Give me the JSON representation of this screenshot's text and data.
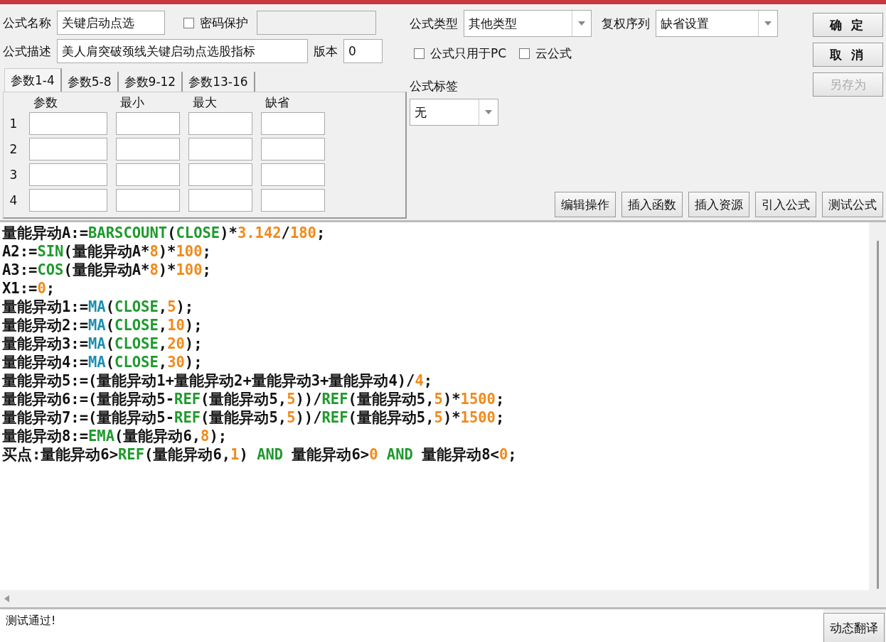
{
  "formula_name": {
    "label": "公式名称",
    "value": "关键启动点选"
  },
  "password": {
    "label": "密码保护",
    "checked": false
  },
  "password_field": {
    "disabled": true
  },
  "description": {
    "label": "公式描述",
    "value": "美人肩突破颈线关键启动点选股指标"
  },
  "version": {
    "label": "版本",
    "value": "0"
  },
  "param_tabs": [
    {
      "label": "参数1-4",
      "selected": true
    },
    {
      "label": "参数5-8",
      "selected": false
    },
    {
      "label": "参数9-12",
      "selected": false
    },
    {
      "label": "参数13-16",
      "selected": false
    }
  ],
  "param_columns": [
    "参数",
    "最小",
    "最大",
    "缺省"
  ],
  "param_rows": [
    "1",
    "2",
    "3",
    "4"
  ],
  "formula_type": {
    "label": "公式类型",
    "value": "其他类型"
  },
  "adjust": {
    "label": "复权序列",
    "value": "缺省设置"
  },
  "options": [
    {
      "label": "公式只用于PC",
      "checked": false
    },
    {
      "label": "云公式",
      "checked": false
    }
  ],
  "tag": {
    "label": "公式标签",
    "value": "无"
  },
  "side_buttons": [
    {
      "label": "确 定",
      "disabled": false
    },
    {
      "label": "取 消",
      "disabled": false
    },
    {
      "label": "另存为",
      "disabled": true
    }
  ],
  "tool_buttons": [
    "编辑操作",
    "插入函数",
    "插入资源",
    "引入公式",
    "测试公式"
  ],
  "code_lines": [
    [
      {
        "kind": "text",
        "text": "量能异动A:="
      },
      {
        "kind": "func",
        "text": "BARSCOUNT"
      },
      {
        "kind": "text",
        "text": "("
      },
      {
        "kind": "func",
        "text": "CLOSE"
      },
      {
        "kind": "text",
        "text": ")*"
      },
      {
        "kind": "number",
        "text": "3.142"
      },
      {
        "kind": "text",
        "text": "/"
      },
      {
        "kind": "number",
        "text": "180"
      },
      {
        "kind": "text",
        "text": ";"
      }
    ],
    [
      {
        "kind": "text",
        "text": "A2:="
      },
      {
        "kind": "func",
        "text": "SIN"
      },
      {
        "kind": "text",
        "text": "(量能异动A*"
      },
      {
        "kind": "number",
        "text": "8"
      },
      {
        "kind": "text",
        "text": ")*"
      },
      {
        "kind": "number",
        "text": "100"
      },
      {
        "kind": "text",
        "text": ";"
      }
    ],
    [
      {
        "kind": "text",
        "text": "A3:="
      },
      {
        "kind": "func",
        "text": "COS"
      },
      {
        "kind": "text",
        "text": "(量能异动A*"
      },
      {
        "kind": "number",
        "text": "8"
      },
      {
        "kind": "text",
        "text": ")*"
      },
      {
        "kind": "number",
        "text": "100"
      },
      {
        "kind": "text",
        "text": ";"
      }
    ],
    [
      {
        "kind": "text",
        "text": "X1:="
      },
      {
        "kind": "number",
        "text": "0"
      },
      {
        "kind": "text",
        "text": ";"
      }
    ],
    [
      {
        "kind": "text",
        "text": "量能异动1:="
      },
      {
        "kind": "builtin",
        "text": "MA"
      },
      {
        "kind": "text",
        "text": "("
      },
      {
        "kind": "func",
        "text": "CLOSE"
      },
      {
        "kind": "text",
        "text": ","
      },
      {
        "kind": "number",
        "text": "5"
      },
      {
        "kind": "text",
        "text": ");"
      }
    ],
    [
      {
        "kind": "text",
        "text": "量能异动2:="
      },
      {
        "kind": "builtin",
        "text": "MA"
      },
      {
        "kind": "text",
        "text": "("
      },
      {
        "kind": "func",
        "text": "CLOSE"
      },
      {
        "kind": "text",
        "text": ","
      },
      {
        "kind": "number",
        "text": "10"
      },
      {
        "kind": "text",
        "text": ");"
      }
    ],
    [
      {
        "kind": "text",
        "text": "量能异动3:="
      },
      {
        "kind": "builtin",
        "text": "MA"
      },
      {
        "kind": "text",
        "text": "("
      },
      {
        "kind": "func",
        "text": "CLOSE"
      },
      {
        "kind": "text",
        "text": ","
      },
      {
        "kind": "number",
        "text": "20"
      },
      {
        "kind": "text",
        "text": ");"
      }
    ],
    [
      {
        "kind": "text",
        "text": "量能异动4:="
      },
      {
        "kind": "builtin",
        "text": "MA"
      },
      {
        "kind": "text",
        "text": "("
      },
      {
        "kind": "func",
        "text": "CLOSE"
      },
      {
        "kind": "text",
        "text": ","
      },
      {
        "kind": "number",
        "text": "30"
      },
      {
        "kind": "text",
        "text": ");"
      }
    ],
    [
      {
        "kind": "text",
        "text": "量能异动5:=(量能异动1+量能异动2+量能异动3+量能异动4)/"
      },
      {
        "kind": "number",
        "text": "4"
      },
      {
        "kind": "text",
        "text": ";"
      }
    ],
    [
      {
        "kind": "text",
        "text": "量能异动6:=(量能异动5-"
      },
      {
        "kind": "func",
        "text": "REF"
      },
      {
        "kind": "text",
        "text": "(量能异动5,"
      },
      {
        "kind": "number",
        "text": "5"
      },
      {
        "kind": "text",
        "text": "))/"
      },
      {
        "kind": "func",
        "text": "REF"
      },
      {
        "kind": "text",
        "text": "(量能异动5,"
      },
      {
        "kind": "number",
        "text": "5"
      },
      {
        "kind": "text",
        "text": ")*"
      },
      {
        "kind": "number",
        "text": "1500"
      },
      {
        "kind": "text",
        "text": ";"
      }
    ],
    [
      {
        "kind": "text",
        "text": "量能异动7:=(量能异动5-"
      },
      {
        "kind": "func",
        "text": "REF"
      },
      {
        "kind": "text",
        "text": "(量能异动5,"
      },
      {
        "kind": "number",
        "text": "5"
      },
      {
        "kind": "text",
        "text": "))/"
      },
      {
        "kind": "func",
        "text": "REF"
      },
      {
        "kind": "text",
        "text": "(量能异动5,"
      },
      {
        "kind": "number",
        "text": "5"
      },
      {
        "kind": "text",
        "text": ")*"
      },
      {
        "kind": "number",
        "text": "1500"
      },
      {
        "kind": "text",
        "text": ";"
      }
    ],
    [
      {
        "kind": "text",
        "text": "量能异动8:="
      },
      {
        "kind": "func",
        "text": "EMA"
      },
      {
        "kind": "text",
        "text": "(量能异动6,"
      },
      {
        "kind": "number",
        "text": "8"
      },
      {
        "kind": "text",
        "text": ");"
      }
    ],
    [
      {
        "kind": "text",
        "text": "买点:量能异动6>"
      },
      {
        "kind": "func",
        "text": "REF"
      },
      {
        "kind": "text",
        "text": "(量能异动6,"
      },
      {
        "kind": "number",
        "text": "1"
      },
      {
        "kind": "text",
        "text": ") "
      },
      {
        "kind": "func",
        "text": "AND"
      },
      {
        "kind": "text",
        "text": " 量能异动6>"
      },
      {
        "kind": "number",
        "text": "0"
      },
      {
        "kind": "func",
        "text": " AND"
      },
      {
        "kind": "text",
        "text": " 量能异动8<"
      },
      {
        "kind": "number",
        "text": "0"
      },
      {
        "kind": "text",
        "text": ";"
      }
    ]
  ],
  "status": {
    "message": "测试通过!",
    "button": "动态翻译"
  }
}
